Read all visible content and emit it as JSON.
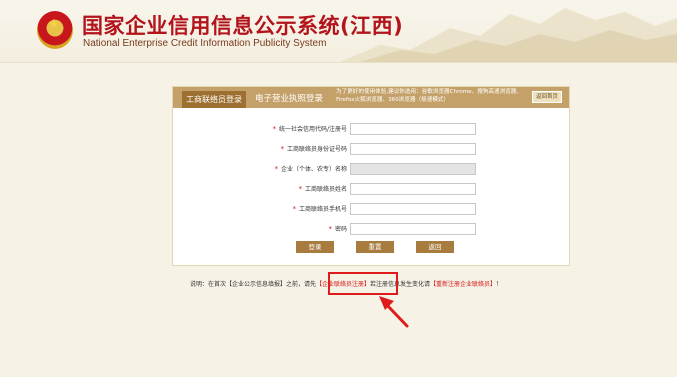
{
  "header": {
    "title": "国家企业信用信息公示系统(江西)",
    "subtitle": "National Enterprise Credit Information Publicity System"
  },
  "tabs": {
    "active": "工商联络员登录",
    "license": "电子营业执照登录"
  },
  "browser_tip": "为了更好的使用体验,建议你选用：谷歌浏览器Chrome、搜狗高速浏览器、Firefox火狐浏览器、360浏览器（极速模式）",
  "back_home": "返回首页",
  "form": {
    "fields": [
      {
        "label": "统一社会信用代码/注册号",
        "required": true,
        "value": "",
        "disabled": false
      },
      {
        "label": "工商联络员身份证号码",
        "required": true,
        "value": "",
        "disabled": false
      },
      {
        "label": "企业（个体、农专）名称",
        "required": true,
        "value": "",
        "disabled": true
      },
      {
        "label": "工商联络员姓名",
        "required": true,
        "value": "",
        "disabled": false
      },
      {
        "label": "工商联络员手机号",
        "required": true,
        "value": "",
        "disabled": false
      },
      {
        "label": "密码",
        "required": true,
        "value": "",
        "disabled": false
      }
    ],
    "buttons": {
      "login": "登录",
      "reset": "重置",
      "back": "返回"
    }
  },
  "note": {
    "prefix": "说明：在首次【企业公示信息填报】之前，请先",
    "register_link": "【企业联络员注册】",
    "middle": "若注册信息发生变化请",
    "reregister_link": "【重新注册企业联络员】",
    "suffix": "！"
  },
  "colors": {
    "accent": "#c5a16a",
    "button": "#a77c3e",
    "title_red": "#b3131b",
    "highlight_red": "#e01b1b"
  }
}
